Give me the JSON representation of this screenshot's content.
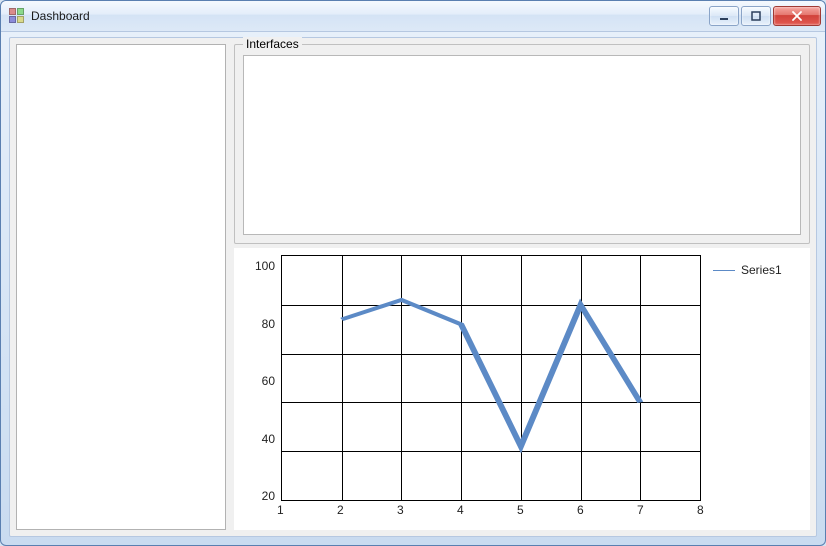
{
  "window": {
    "title": "Dashboard",
    "buttons": {
      "minimize": "minimize",
      "maximize": "maximize",
      "close": "close"
    }
  },
  "left_panel": {},
  "groupbox": {
    "interfaces_label": "Interfaces"
  },
  "chart": {
    "y_ticks": [
      "100",
      "80",
      "60",
      "40",
      "20"
    ],
    "x_ticks": [
      "1",
      "2",
      "3",
      "4",
      "5",
      "6",
      "7",
      "8"
    ],
    "legend": {
      "series1": "Series1"
    }
  },
  "chart_data": {
    "type": "line",
    "title": "",
    "xlabel": "",
    "ylabel": "",
    "xlim": [
      1,
      8
    ],
    "ylim": [
      0,
      100
    ],
    "x": [
      2,
      3,
      4,
      5,
      6,
      7
    ],
    "series": [
      {
        "name": "Series1",
        "values": [
          74,
          82,
          72,
          22,
          80,
          40
        ],
        "color": "#5c8ac6"
      }
    ],
    "grid": true,
    "legend_position": "right"
  }
}
